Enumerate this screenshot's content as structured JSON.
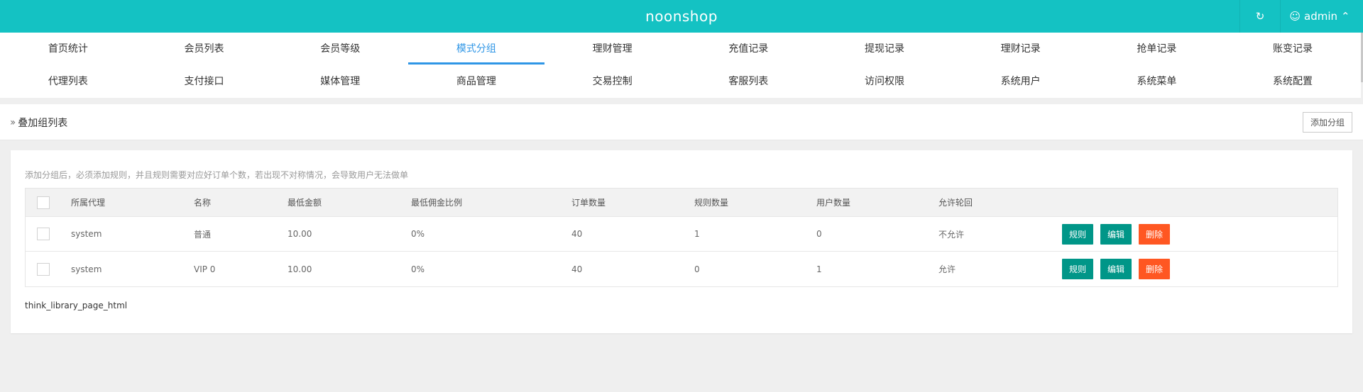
{
  "header": {
    "brand": "noonshop",
    "user": "admin",
    "accent": "#14c2c3"
  },
  "nav": {
    "row1": [
      "首页统计",
      "会员列表",
      "会员等级",
      "模式分组",
      "理财管理",
      "充值记录",
      "提现记录",
      "理财记录",
      "抢单记录",
      "账变记录"
    ],
    "row2": [
      "代理列表",
      "支付接口",
      "媒体管理",
      "商品管理",
      "交易控制",
      "客服列表",
      "访问权限",
      "系统用户",
      "系统菜单",
      "系统配置"
    ],
    "active": "模式分组",
    "active_color": "#2f96e6"
  },
  "breadcrumb": {
    "title": "叠加组列表",
    "add_button": "添加分组"
  },
  "notice": "添加分组后，必须添加规则，并且规则需要对应好订单个数，若出现不对称情况，会导致用户无法做单",
  "table": {
    "headers": {
      "agent": "所属代理",
      "name": "名称",
      "min_amount": "最低金额",
      "min_rate": "最低佣金比例",
      "orders": "订单数量",
      "rules": "规则数量",
      "users": "用户数量",
      "allow_return": "允许轮回"
    },
    "rows": [
      {
        "agent": "system",
        "name": "普通",
        "min_amount": "10.00",
        "min_rate": "0%",
        "orders": "40",
        "rules": "1",
        "users": "0",
        "allow_return": "不允许"
      },
      {
        "agent": "system",
        "name": "VIP 0",
        "min_amount": "10.00",
        "min_rate": "0%",
        "orders": "40",
        "rules": "0",
        "users": "1",
        "allow_return": "允许"
      }
    ],
    "actions": {
      "rule": "规则",
      "edit": "编辑",
      "delete": "删除"
    }
  },
  "pager_text": "think_library_page_html"
}
